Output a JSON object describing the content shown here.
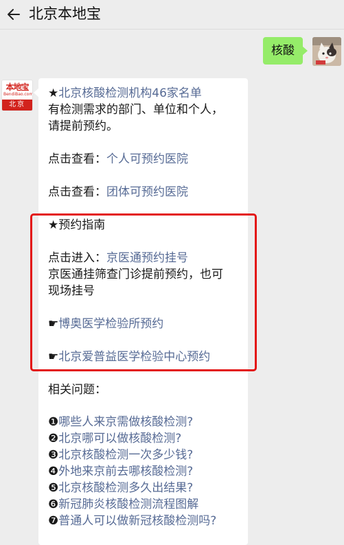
{
  "header": {
    "title": "北京本地宝"
  },
  "user_message": {
    "text": "核酸"
  },
  "bot_avatar": {
    "logo_main": "本地宝",
    "logo_sub": "BendiBao.com",
    "logo_city": "北京"
  },
  "reply": {
    "head_star": "★",
    "head_link": "北京核酸检测机构46家名单",
    "intro_line1": "有检测需求的部门、单位和个人，",
    "intro_line2": "请提前预约。",
    "view1_prefix": "点击查看：",
    "view1_link": "个人可预约医院",
    "view2_prefix": "点击查看：",
    "view2_link": "团体可预约医院",
    "guide_title": "★预约指南",
    "enter_prefix": "点击进入：",
    "enter_link": "京医通预约挂号",
    "note_line1": "京医通挂筛查门诊提前预约，也可",
    "note_line2": "现场挂号",
    "pointer1": "☛",
    "booking_link1": "博奥医学检验所预约",
    "pointer2": "☛",
    "booking_link2": "北京爱普益医学检验中心预约",
    "related_title": "相关问题：",
    "questions": [
      {
        "num": "❶",
        "text": "哪些人来京需做核酸检测?"
      },
      {
        "num": "❷",
        "text": "北京哪可以做核酸检测?"
      },
      {
        "num": "❸",
        "text": "北京核酸检测一次多少钱?"
      },
      {
        "num": "❹",
        "text": "外地来京前去哪核酸检测?"
      },
      {
        "num": "❺",
        "text": "北京核酸检测多久出结果?"
      },
      {
        "num": "❻",
        "text": "新冠肺炎核酸检测流程图解"
      },
      {
        "num": "❼",
        "text": "普通人可以做新冠核酸检测吗?"
      }
    ]
  },
  "colors": {
    "link": "#576b95",
    "user_bubble": "#95ec69",
    "highlight_box": "#e31212",
    "logo_red": "#d2231d"
  }
}
